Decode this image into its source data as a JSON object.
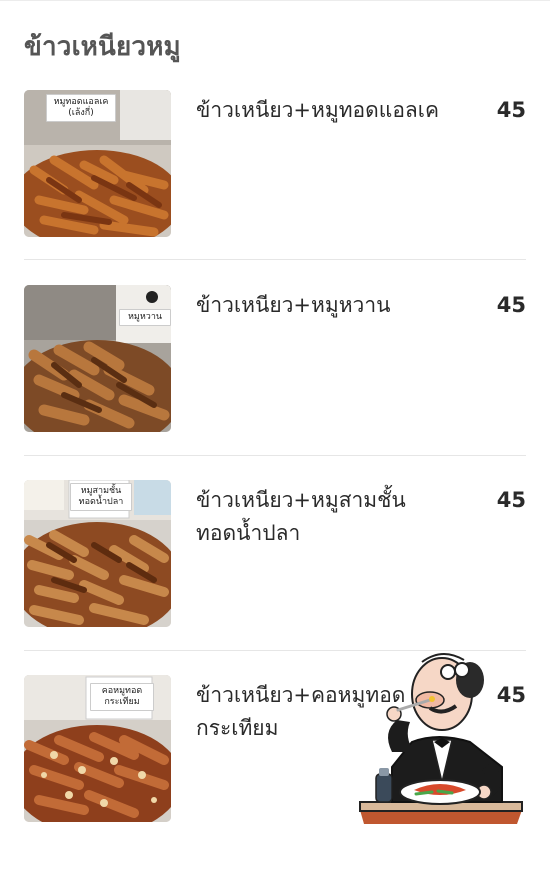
{
  "section": {
    "title": "ข้าวเหนียวหมู"
  },
  "items": [
    {
      "name": "ข้าวเหนียว+หมูทอดแอลเค",
      "price": "45",
      "sign": "หมูทอดแอลเค (เล้งกี่)",
      "photo": "fried-pork-photo"
    },
    {
      "name": "ข้าวเหนียว+หมูหวาน",
      "price": "45",
      "sign": "หมูหวาน",
      "photo": "sweet-pork-photo"
    },
    {
      "name": "ข้าวเหนียว+หมูสามชั้นทอดน้ำปลา",
      "price": "45",
      "sign": "หมูสามชั้น ทอดน้ำปลา",
      "photo": "pork-belly-photo"
    },
    {
      "name": "ข้าวเหนียว+คอหมูทอดกระเทียม",
      "price": "45",
      "sign": "คอหมูทอด กระเทียม",
      "photo": "garlic-pork-neck-photo"
    }
  ],
  "overlay": {
    "icon": "chef-eating-icon"
  }
}
